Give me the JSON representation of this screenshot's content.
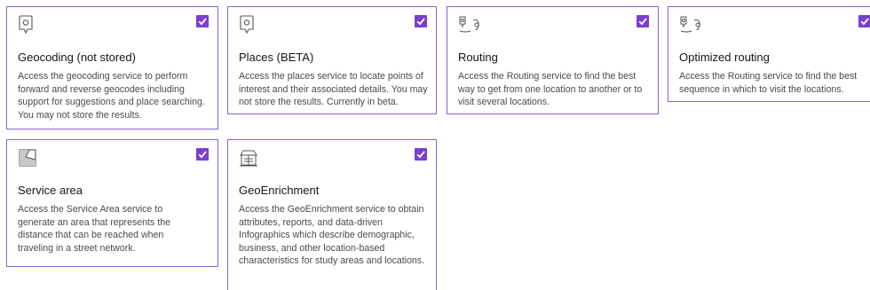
{
  "cards": [
    {
      "id": "geocoding",
      "icon": "location-pin-icon",
      "title": "Geocoding (not stored)",
      "description": "Access the geocoding service to perform forward and reverse geocodes including support for suggestions and place searching. You may not store the results.",
      "checked": true
    },
    {
      "id": "places",
      "icon": "location-pin-icon",
      "title": "Places (BETA)",
      "description": "Access the places service to locate points of interest and their associated details. You may not store the results. Currently in beta.",
      "checked": true
    },
    {
      "id": "routing",
      "icon": "route-icon",
      "title": "Routing",
      "description": "Access the Routing service to find the best way to get from one location to another or to visit several locations.",
      "checked": true
    },
    {
      "id": "optimized-routing",
      "icon": "route-icon",
      "title": "Optimized routing",
      "description": "Access the Routing service to find the best sequence in which to visit the locations.",
      "checked": true
    },
    {
      "id": "service-area",
      "icon": "service-area-icon",
      "title": "Service area",
      "description": "Access the Service Area service to generate an area that represents the distance that can be reached when traveling in a street network.",
      "checked": true
    },
    {
      "id": "geoenrichment",
      "icon": "geoenrichment-icon",
      "title": "GeoEnrichment",
      "description": "Access the GeoEnrichment service to obtain attributes, reports, and data-driven Infographics which describe demographic, business, and other location-based characteristics for study areas and locations.",
      "checked": true
    }
  ],
  "colors": {
    "accent": "#7a3fcf",
    "border": "#8a63d2"
  }
}
